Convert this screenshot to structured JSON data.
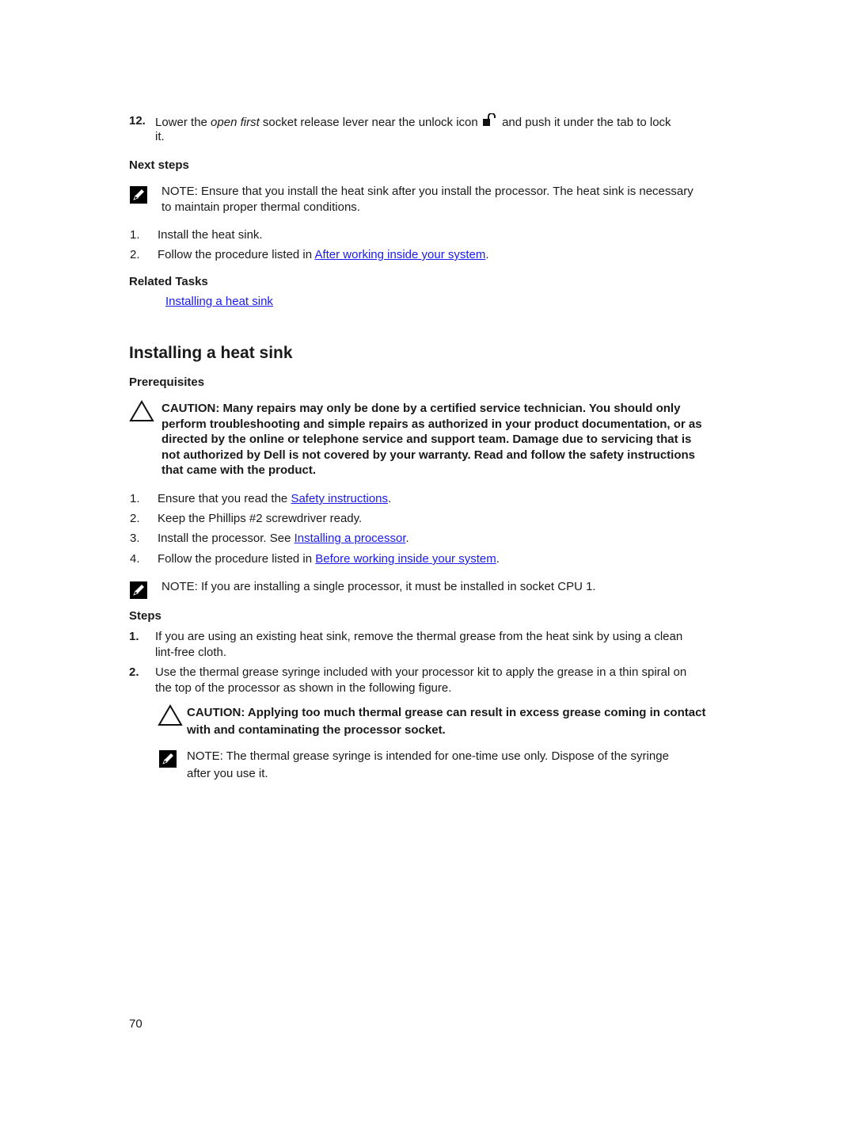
{
  "step12": {
    "number": "12.",
    "text_before": "Lower the ",
    "italic": "open first",
    "text_mid": " socket release lever near the unlock icon",
    "text_after": " and push it under the tab to lock",
    "text_wrap": "it.",
    "icon": "unlock-icon"
  },
  "next_steps": {
    "heading": "Next steps",
    "note": {
      "label": "NOTE:",
      "line1": " Ensure that you install the heat sink after you install the processor. The heat sink is necessary",
      "line2": "to maintain proper thermal conditions.",
      "icon": "note-pencil-icon"
    },
    "items": [
      {
        "num": "1.",
        "text": "Install the heat sink."
      },
      {
        "num": "2.",
        "text": "Follow the procedure listed in ",
        "link": "After working inside your system",
        "suffix": "."
      }
    ]
  },
  "related_tasks": {
    "heading": "Related Tasks",
    "link": "Installing a heat sink"
  },
  "section": {
    "title": "Installing a heat sink",
    "prerequisites": {
      "heading": "Prerequisites",
      "caution": {
        "icon": "caution-triangle-icon",
        "lines": [
          "CAUTION: Many repairs may only be done by a certified service technician. You should only",
          "perform troubleshooting and simple repairs as authorized in your product documentation, or as",
          "directed by the online or telephone service and support team. Damage due to servicing that is",
          "not authorized by Dell is not covered by your warranty. Read and follow the safety instructions",
          "that came with the product."
        ]
      },
      "items": [
        {
          "num": "1.",
          "text": "Ensure that you read the ",
          "link": "Safety instructions",
          "suffix": "."
        },
        {
          "num": "2.",
          "text": "Keep the Phillips #2 screwdriver ready."
        },
        {
          "num": "3.",
          "text": "Install the processor. See ",
          "link": "Installing a processor",
          "suffix": "."
        },
        {
          "num": "4.",
          "text": "Follow the procedure listed in ",
          "link": "Before working inside your system",
          "suffix": "."
        }
      ],
      "note": {
        "label": "NOTE:",
        "text": " If you are installing a single processor, it must be installed in socket CPU 1."
      }
    },
    "steps": {
      "heading": "Steps",
      "items": [
        {
          "num": "1.",
          "line1": "If you are using an existing heat sink, remove the thermal grease from the heat sink by using a clean",
          "line2": "lint-free cloth."
        },
        {
          "num": "2.",
          "line1": "Use the thermal grease syringe included with your processor kit to apply the grease in a thin spiral on",
          "line2": "the top of the processor as shown in the following figure."
        }
      ],
      "caution": {
        "line1": "CAUTION: Applying too much thermal grease can result in excess grease coming in contact",
        "line2": "with and contaminating the processor socket."
      },
      "note": {
        "label": "NOTE:",
        "line1": " The thermal grease syringe is intended for one-time use only. Dispose of the syringe",
        "line2": "after you use it."
      }
    }
  },
  "page_number": "70"
}
